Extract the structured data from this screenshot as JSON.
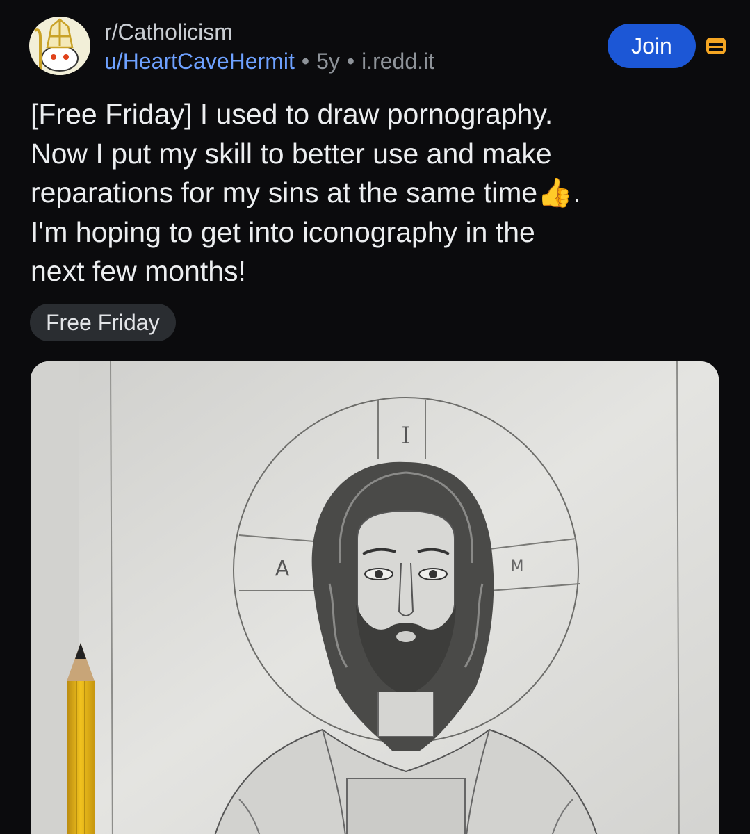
{
  "post": {
    "subreddit": "r/Catholicism",
    "author": "u/HeartCaveHermit",
    "age": "5y",
    "domain": "i.redd.it",
    "separator": "•",
    "join_label": "Join",
    "title_lines": [
      "[Free Friday] I used to draw pornography.",
      "Now I put my skill to better use and make",
      "reparations for my sins at the same time👍.",
      "I'm hoping to get into iconography in the",
      "next few months!"
    ],
    "flair": "Free Friday"
  },
  "image": {
    "letters": {
      "top": "I",
      "left": "A",
      "right": "M"
    }
  },
  "colors": {
    "background": "#0b0b0d",
    "join_button": "#1c57d6",
    "author_link": "#6ea1ff",
    "mod_icon": "#f5a623"
  },
  "icons": {
    "avatar": "subreddit-mitre-avatar",
    "mod": "mod-shield-icon"
  }
}
